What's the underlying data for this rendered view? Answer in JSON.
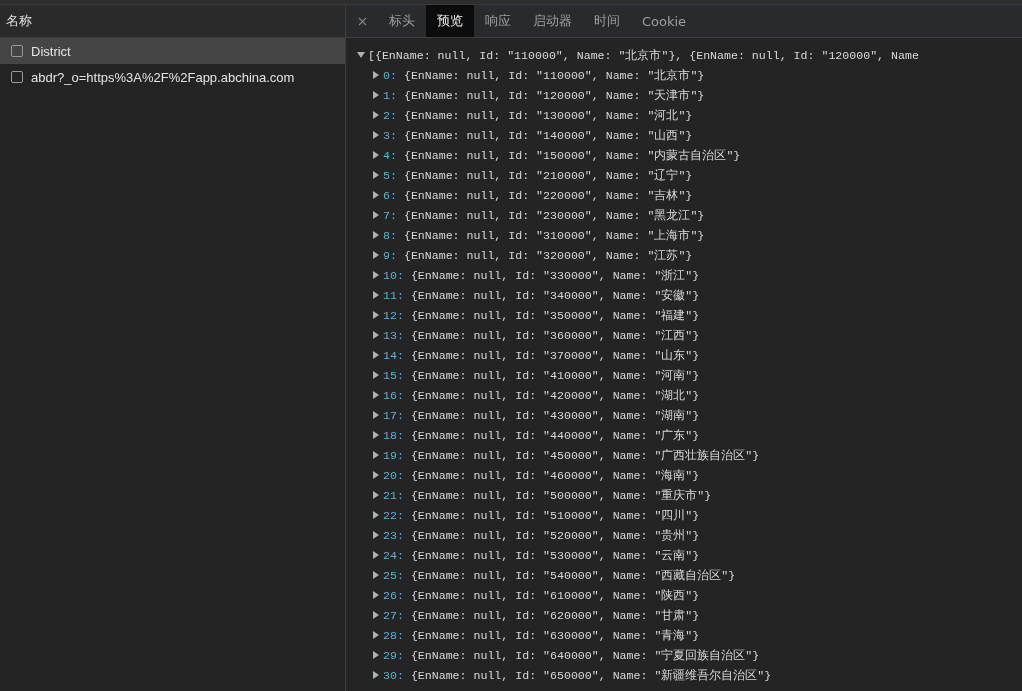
{
  "requests": {
    "header": "名称",
    "items": [
      {
        "name": "District",
        "selected": true
      },
      {
        "name": "abdr?_o=https%3A%2F%2Fapp.abchina.com",
        "selected": false
      }
    ]
  },
  "tabs": [
    {
      "label": "标头",
      "selected": false
    },
    {
      "label": "预览",
      "selected": true
    },
    {
      "label": "响应",
      "selected": false
    },
    {
      "label": "启动器",
      "selected": false
    },
    {
      "label": "时间",
      "selected": false
    },
    {
      "label": "Cookie",
      "selected": false
    }
  ],
  "preview": {
    "root": {
      "text": "[{EnName: null, Id: \"110000\", Name: \"北京市\"}, {EnName: null, Id: \"120000\", Name",
      "expanded": true
    },
    "rows": [
      {
        "index": "0:",
        "text": "{EnName: null, Id: \"110000\", Name: \"北京市\"}",
        "expanded": false
      },
      {
        "index": "1:",
        "text": "{EnName: null, Id: \"120000\", Name: \"天津市\"}",
        "expanded": false
      },
      {
        "index": "2:",
        "text": "{EnName: null, Id: \"130000\", Name: \"河北\"}",
        "expanded": false
      },
      {
        "index": "3:",
        "text": "{EnName: null, Id: \"140000\", Name: \"山西\"}",
        "expanded": false
      },
      {
        "index": "4:",
        "text": "{EnName: null, Id: \"150000\", Name: \"内蒙古自治区\"}",
        "expanded": false
      },
      {
        "index": "5:",
        "text": "{EnName: null, Id: \"210000\", Name: \"辽宁\"}",
        "expanded": false
      },
      {
        "index": "6:",
        "text": "{EnName: null, Id: \"220000\", Name: \"吉林\"}",
        "expanded": false
      },
      {
        "index": "7:",
        "text": "{EnName: null, Id: \"230000\", Name: \"黑龙江\"}",
        "expanded": false
      },
      {
        "index": "8:",
        "text": "{EnName: null, Id: \"310000\", Name: \"上海市\"}",
        "expanded": false
      },
      {
        "index": "9:",
        "text": "{EnName: null, Id: \"320000\", Name: \"江苏\"}",
        "expanded": false
      },
      {
        "index": "10:",
        "text": "{EnName: null, Id: \"330000\", Name: \"浙江\"}",
        "expanded": false
      },
      {
        "index": "11:",
        "text": "{EnName: null, Id: \"340000\", Name: \"安徽\"}",
        "expanded": false
      },
      {
        "index": "12:",
        "text": "{EnName: null, Id: \"350000\", Name: \"福建\"}",
        "expanded": false
      },
      {
        "index": "13:",
        "text": "{EnName: null, Id: \"360000\", Name: \"江西\"}",
        "expanded": false
      },
      {
        "index": "14:",
        "text": "{EnName: null, Id: \"370000\", Name: \"山东\"}",
        "expanded": false
      },
      {
        "index": "15:",
        "text": "{EnName: null, Id: \"410000\", Name: \"河南\"}",
        "expanded": false
      },
      {
        "index": "16:",
        "text": "{EnName: null, Id: \"420000\", Name: \"湖北\"}",
        "expanded": false
      },
      {
        "index": "17:",
        "text": "{EnName: null, Id: \"430000\", Name: \"湖南\"}",
        "expanded": false
      },
      {
        "index": "18:",
        "text": "{EnName: null, Id: \"440000\", Name: \"广东\"}",
        "expanded": false
      },
      {
        "index": "19:",
        "text": "{EnName: null, Id: \"450000\", Name: \"广西壮族自治区\"}",
        "expanded": false
      },
      {
        "index": "20:",
        "text": "{EnName: null, Id: \"460000\", Name: \"海南\"}",
        "expanded": false
      },
      {
        "index": "21:",
        "text": "{EnName: null, Id: \"500000\", Name: \"重庆市\"}",
        "expanded": false
      },
      {
        "index": "22:",
        "text": "{EnName: null, Id: \"510000\", Name: \"四川\"}",
        "expanded": false
      },
      {
        "index": "23:",
        "text": "{EnName: null, Id: \"520000\", Name: \"贵州\"}",
        "expanded": false
      },
      {
        "index": "24:",
        "text": "{EnName: null, Id: \"530000\", Name: \"云南\"}",
        "expanded": false
      },
      {
        "index": "25:",
        "text": "{EnName: null, Id: \"540000\", Name: \"西藏自治区\"}",
        "expanded": false
      },
      {
        "index": "26:",
        "text": "{EnName: null, Id: \"610000\", Name: \"陕西\"}",
        "expanded": false
      },
      {
        "index": "27:",
        "text": "{EnName: null, Id: \"620000\", Name: \"甘肃\"}",
        "expanded": false
      },
      {
        "index": "28:",
        "text": "{EnName: null, Id: \"630000\", Name: \"青海\"}",
        "expanded": false
      },
      {
        "index": "29:",
        "text": "{EnName: null, Id: \"640000\", Name: \"宁夏回族自治区\"}",
        "expanded": false
      },
      {
        "index": "30:",
        "text": "{EnName: null, Id: \"650000\", Name: \"新疆维吾尔自治区\"}",
        "expanded": false
      }
    ]
  }
}
